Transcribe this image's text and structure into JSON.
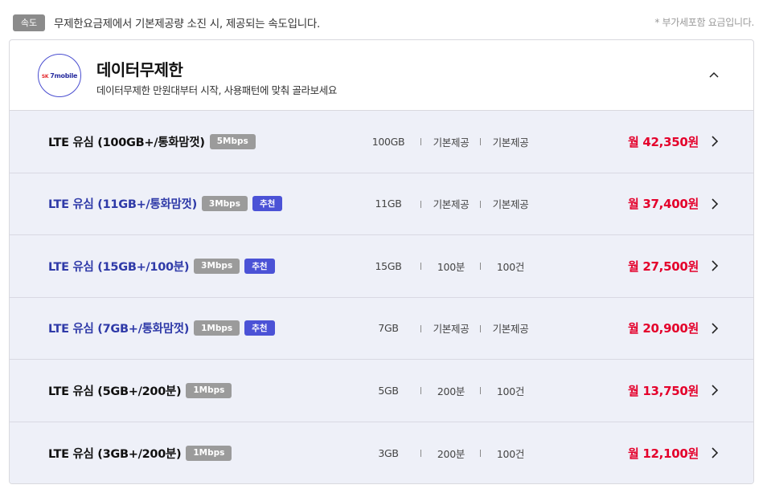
{
  "notice": {
    "tag": "속도",
    "text": "무제한요금제에서 기본제공량 소진 시, 제공되는 속도입니다.",
    "vat_note": "* 부가세포함 요금입니다."
  },
  "header": {
    "logo_brand": "SK",
    "logo_text": "7mobile",
    "title": "데이터무제한",
    "description": "데이터무제한 만원대부터 시작, 사용패턴에 맞춰 골라보세요"
  },
  "plans": [
    {
      "name": "LTE 유심 (100GB+/통화맘껏)",
      "speed": "5Mbps",
      "recommended": "",
      "data": "100GB",
      "voice": "기본제공",
      "sms": "기본제공",
      "price": "월 42,350원"
    },
    {
      "name": "LTE 유심 (11GB+/통화맘껏)",
      "speed": "3Mbps",
      "recommended": "추천",
      "data": "11GB",
      "voice": "기본제공",
      "sms": "기본제공",
      "price": "월 37,400원"
    },
    {
      "name": "LTE 유심 (15GB+/100분)",
      "speed": "3Mbps",
      "recommended": "추천",
      "data": "15GB",
      "voice": "100분",
      "sms": "100건",
      "price": "월 27,500원"
    },
    {
      "name": "LTE 유심 (7GB+/통화맘껏)",
      "speed": "1Mbps",
      "recommended": "추천",
      "data": "7GB",
      "voice": "기본제공",
      "sms": "기본제공",
      "price": "월 20,900원"
    },
    {
      "name": "LTE 유심 (5GB+/200분)",
      "speed": "1Mbps",
      "recommended": "",
      "data": "5GB",
      "voice": "200분",
      "sms": "100건",
      "price": "월 13,750원"
    },
    {
      "name": "LTE 유심 (3GB+/200분)",
      "speed": "1Mbps",
      "recommended": "",
      "data": "3GB",
      "voice": "200분",
      "sms": "100건",
      "price": "월 12,100원"
    }
  ],
  "icons": {
    "collapse": "chevron-up-icon",
    "row_arrow": "chevron-right-icon"
  },
  "colors": {
    "price": "#e4002b",
    "recommended_name": "#2f3aa8",
    "recommend_badge": "#4b52d6",
    "speed_badge": "#9b9b9b",
    "list_background": "#eef0f8"
  }
}
